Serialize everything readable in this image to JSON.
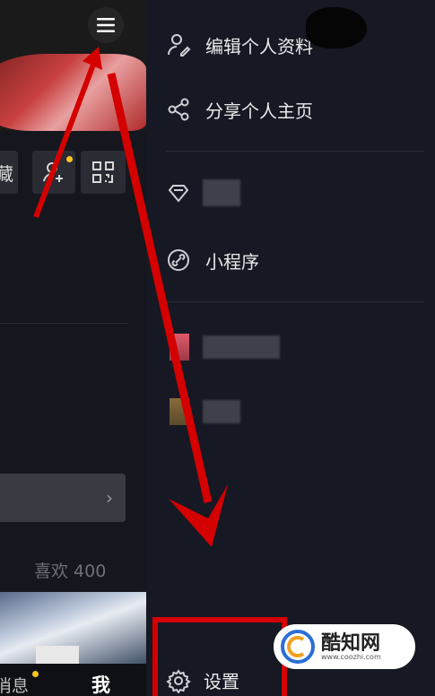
{
  "left_page": {
    "favorites_label": "藏",
    "likes_label": "喜欢 400",
    "tabs": {
      "messages": "消息",
      "me": "我"
    }
  },
  "drawer": {
    "items": [
      {
        "label": "编辑个人资料",
        "icon": "edit-profile-icon"
      },
      {
        "label": "分享个人主页",
        "icon": "share-icon"
      },
      {
        "label": "",
        "icon": "diamond-icon"
      },
      {
        "label": "小程序",
        "icon": "link-icon"
      }
    ],
    "settings": {
      "label": "设置",
      "icon": "gear-icon"
    }
  },
  "watermark": {
    "brand": "酷知网",
    "url": "www.coozhi.com"
  },
  "colors": {
    "annotation_red": "#d40000",
    "drawer_bg": "#161823",
    "notice_dot": "#f5c623"
  }
}
